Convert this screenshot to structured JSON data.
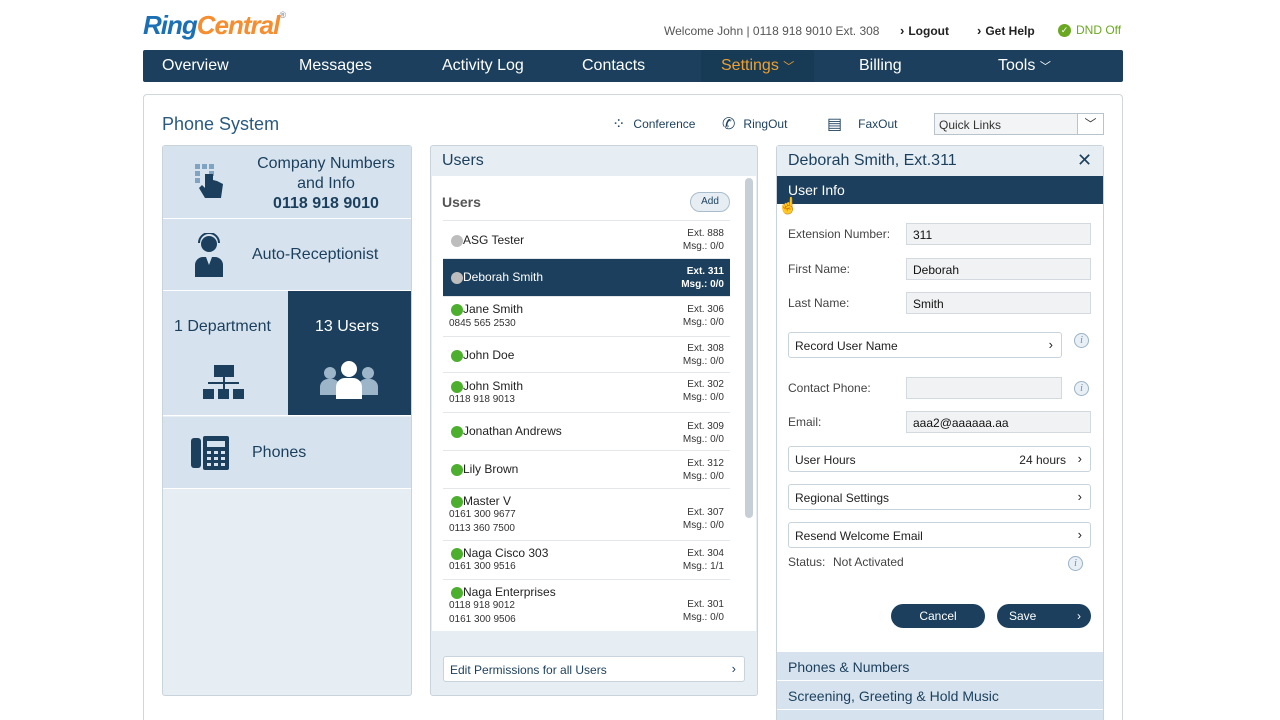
{
  "brand": {
    "part1": "Ring",
    "part2": "Central",
    "reg": "®"
  },
  "header": {
    "welcome": "Welcome John | 0118 918 9010 Ext. 308",
    "logout": "Logout",
    "help": "Get Help",
    "dnd": "DND Off"
  },
  "nav": {
    "items": [
      "Overview",
      "Messages",
      "Activity Log",
      "Contacts",
      "Settings",
      "Billing",
      "Tools"
    ],
    "active": "Settings",
    "active_color": "#f0a030"
  },
  "page": {
    "title": "Phone System",
    "tools": [
      "Conference",
      "RingOut",
      "FaxOut"
    ],
    "quick_links": "Quick Links"
  },
  "left": {
    "company_line1": "Company Numbers",
    "company_line2": "and Info",
    "company_number": "0118 918 9010",
    "auto_receptionist": "Auto-Receptionist",
    "department": "1 Department",
    "users": "13 Users",
    "phones": "Phones"
  },
  "users_panel": {
    "title": "Users",
    "list_title": "Users",
    "add": "Add",
    "rows": [
      {
        "name": "ASG Tester",
        "phones": [],
        "ext": "Ext. 888",
        "msg": "Msg.: 0/0",
        "status": "grey"
      },
      {
        "name": "Deborah Smith",
        "phones": [],
        "ext": "Ext. 311",
        "msg": "Msg.: 0/0",
        "status": "grey",
        "selected": true
      },
      {
        "name": "Jane Smith",
        "phones": [
          "0845 565 2530"
        ],
        "ext": "Ext. 306",
        "msg": "Msg.: 0/0",
        "status": "green"
      },
      {
        "name": "John Doe",
        "phones": [],
        "ext": "Ext. 308",
        "msg": "Msg.: 0/0",
        "status": "green"
      },
      {
        "name": "John Smith",
        "phones": [
          "0118 918 9013"
        ],
        "ext": "Ext. 302",
        "msg": "Msg.: 0/0",
        "status": "green"
      },
      {
        "name": "Jonathan Andrews",
        "phones": [],
        "ext": "Ext. 309",
        "msg": "Msg.: 0/0",
        "status": "green"
      },
      {
        "name": "Lily Brown",
        "phones": [],
        "ext": "Ext. 312",
        "msg": "Msg.: 0/0",
        "status": "green"
      },
      {
        "name": "Master V",
        "phones": [
          "0161 300 9677",
          "0113 360 7500"
        ],
        "ext": "Ext. 307",
        "msg": "Msg.: 0/0",
        "status": "green"
      },
      {
        "name": "Naga Cisco 303",
        "phones": [
          "0161 300 9516"
        ],
        "ext": "Ext. 304",
        "msg": "Msg.: 1/1",
        "status": "green"
      },
      {
        "name": "Naga Enterprises",
        "phones": [
          "0118 918 9012",
          "0161 300 9506"
        ],
        "ext": "Ext. 301",
        "msg": "Msg.: 0/0",
        "status": "green"
      }
    ],
    "edit_permissions": "Edit Permissions for all Users"
  },
  "detail": {
    "title": "Deborah Smith, Ext.311",
    "tab": "User Info",
    "ext_label": "Extension Number:",
    "ext_value": "311",
    "first_label": "First Name:",
    "first_value": "Deborah",
    "last_label": "Last Name:",
    "last_value": "Smith",
    "record_name": "Record User Name",
    "contact_label": "Contact Phone:",
    "contact_value": "",
    "email_label": "Email:",
    "email_value": "aaa2@aaaaaa.aa",
    "user_hours": "User Hours",
    "user_hours_value": "24 hours",
    "regional": "Regional Settings",
    "resend": "Resend Welcome Email",
    "status_label": "Status:",
    "status_value": "Not Activated",
    "cancel": "Cancel",
    "save": "Save",
    "sections": [
      "Phones & Numbers",
      "Screening, Greeting & Hold Music"
    ]
  }
}
